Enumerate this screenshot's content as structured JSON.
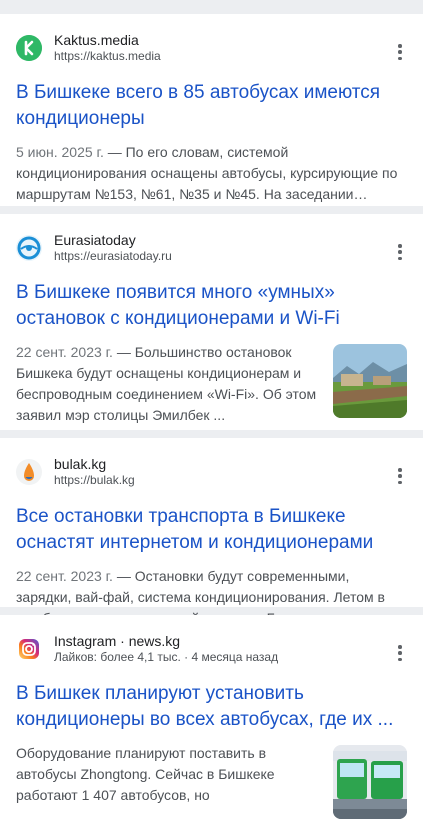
{
  "results": [
    {
      "site_name": "Kaktus.media",
      "url": "https://kaktus.media",
      "favicon": "kaktus-logo-icon",
      "title": "В Бишкеке всего в 85 автобусах имеются кондиционеры",
      "date": "5 июн. 2025 г.",
      "snippet": " — По его словам, системой кондиционирования оснащены автобусы, курсирующие по маршрутам №153, №61, №35 и №45. На заседании…"
    },
    {
      "site_name": "Eurasiatoday",
      "url": "https://eurasiatoday.ru",
      "favicon": "eurasiatoday-logo-icon",
      "title": "В Бишкеке появится много «умных» остановок с кондиционерами и Wi-Fi",
      "date": "22 сент. 2023 г.",
      "snippet": " — Большинство остановок Бишкека будут оснащены кондиционерам и беспроводным соединением «Wi-Fi». Об этом заявил мэр столицы Эмилбек ..."
    },
    {
      "site_name": "bulak.kg",
      "url": "https://bulak.kg",
      "favicon": "bulak-logo-icon",
      "title": "Все остановки транспорта в Бишкеке оснастят интернетом и кондиционерами",
      "date": "22 сент. 2023 г.",
      "snippet": " — Остановки будут современными, зарядки, вай-фай, система кондиционирования. Летом в них будет прохладно, зимой — тепло. Будет…"
    },
    {
      "site_name": "Instagram · news.kg",
      "meta": "Лайков: более 4,1 тыс. · 4 месяца назад",
      "favicon": "instagram-logo-icon",
      "title": "В Бишкек планируют установить кондиционеры во всех автобусах, где их ...",
      "snippet": "Оборудование планируют поставить в автобусы Zhongtong. Сейчас в Бишкеке работают 1 407 автобусов, но"
    }
  ],
  "more_options_label": "⋮"
}
